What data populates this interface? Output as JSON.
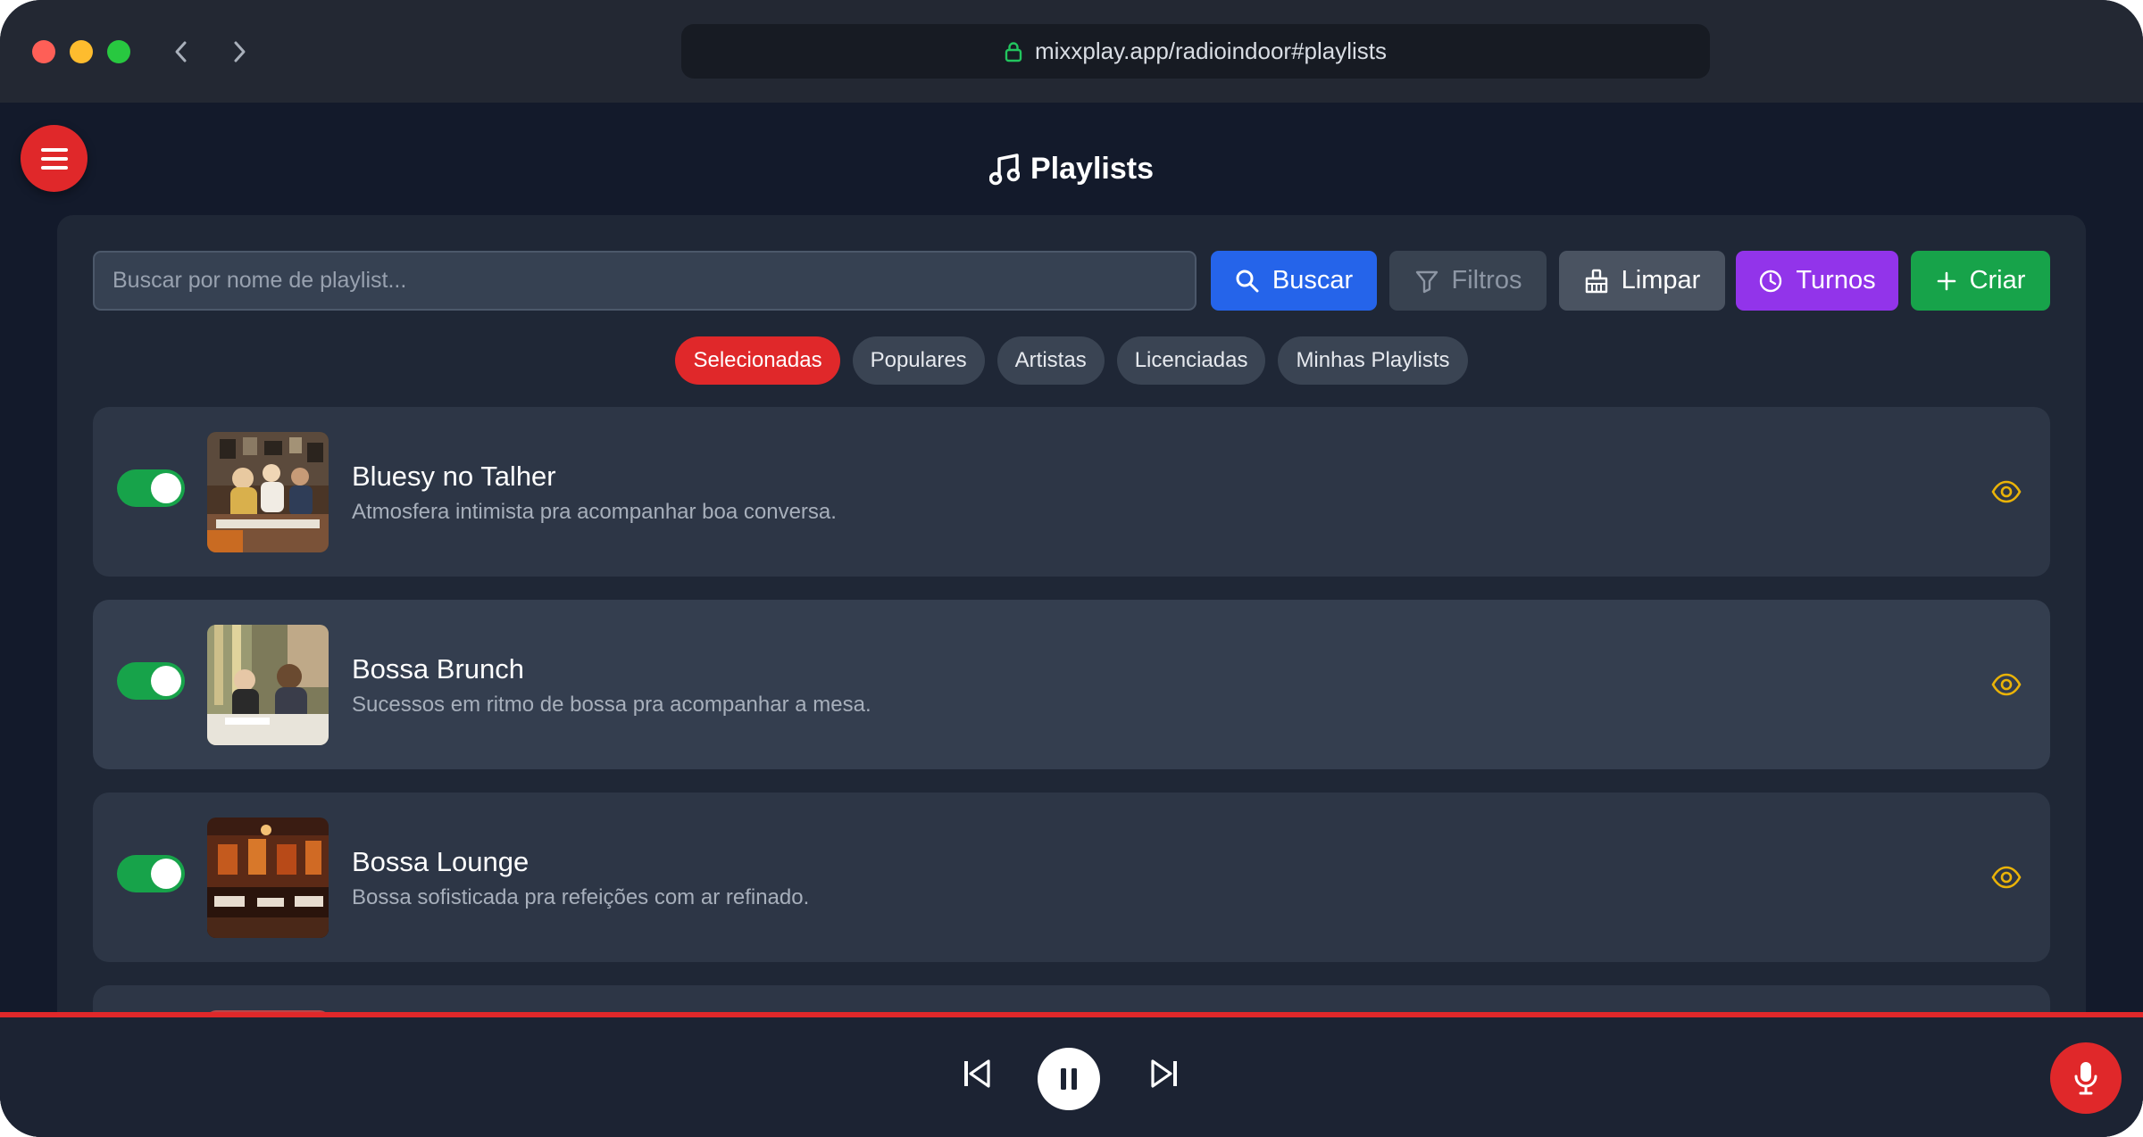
{
  "browser": {
    "url": "mixxplay.app/radioindoor#playlists"
  },
  "page": {
    "title": "Playlists"
  },
  "toolbar": {
    "search_placeholder": "Buscar por nome de playlist...",
    "buscar": "Buscar",
    "filtros": "Filtros",
    "limpar": "Limpar",
    "turnos": "Turnos",
    "criar": "Criar"
  },
  "tabs": [
    {
      "label": "Selecionadas",
      "active": true
    },
    {
      "label": "Populares",
      "active": false
    },
    {
      "label": "Artistas",
      "active": false
    },
    {
      "label": "Licenciadas",
      "active": false
    },
    {
      "label": "Minhas Playlists",
      "active": false
    }
  ],
  "playlists": [
    {
      "title": "Bluesy no Talher",
      "description": "Atmosfera intimista pra acompanhar boa conversa.",
      "enabled": true
    },
    {
      "title": "Bossa Brunch",
      "description": "Sucessos em ritmo de bossa pra acompanhar a mesa.",
      "enabled": true
    },
    {
      "title": "Bossa Lounge",
      "description": "Bossa sofisticada pra refeições com ar refinado.",
      "enabled": true
    }
  ],
  "colors": {
    "accent_red": "#e0282a",
    "buscar_blue": "#2564ea",
    "turnos_purple": "#9234ea",
    "criar_green": "#17a34a",
    "toggle_on": "#17a34a",
    "eye_yellow": "#eab308",
    "background": "#131a2b"
  },
  "icons": {
    "lock": "lock-icon",
    "music": "music-note-icon",
    "menu": "hamburger-icon",
    "search": "search-icon",
    "filter": "filter-icon",
    "clear": "broom-icon",
    "clock": "clock-icon",
    "plus": "plus-icon",
    "view": "eye-icon",
    "prev": "skip-back-icon",
    "pause": "pause-icon",
    "next": "skip-forward-icon",
    "mic": "microphone-icon"
  }
}
